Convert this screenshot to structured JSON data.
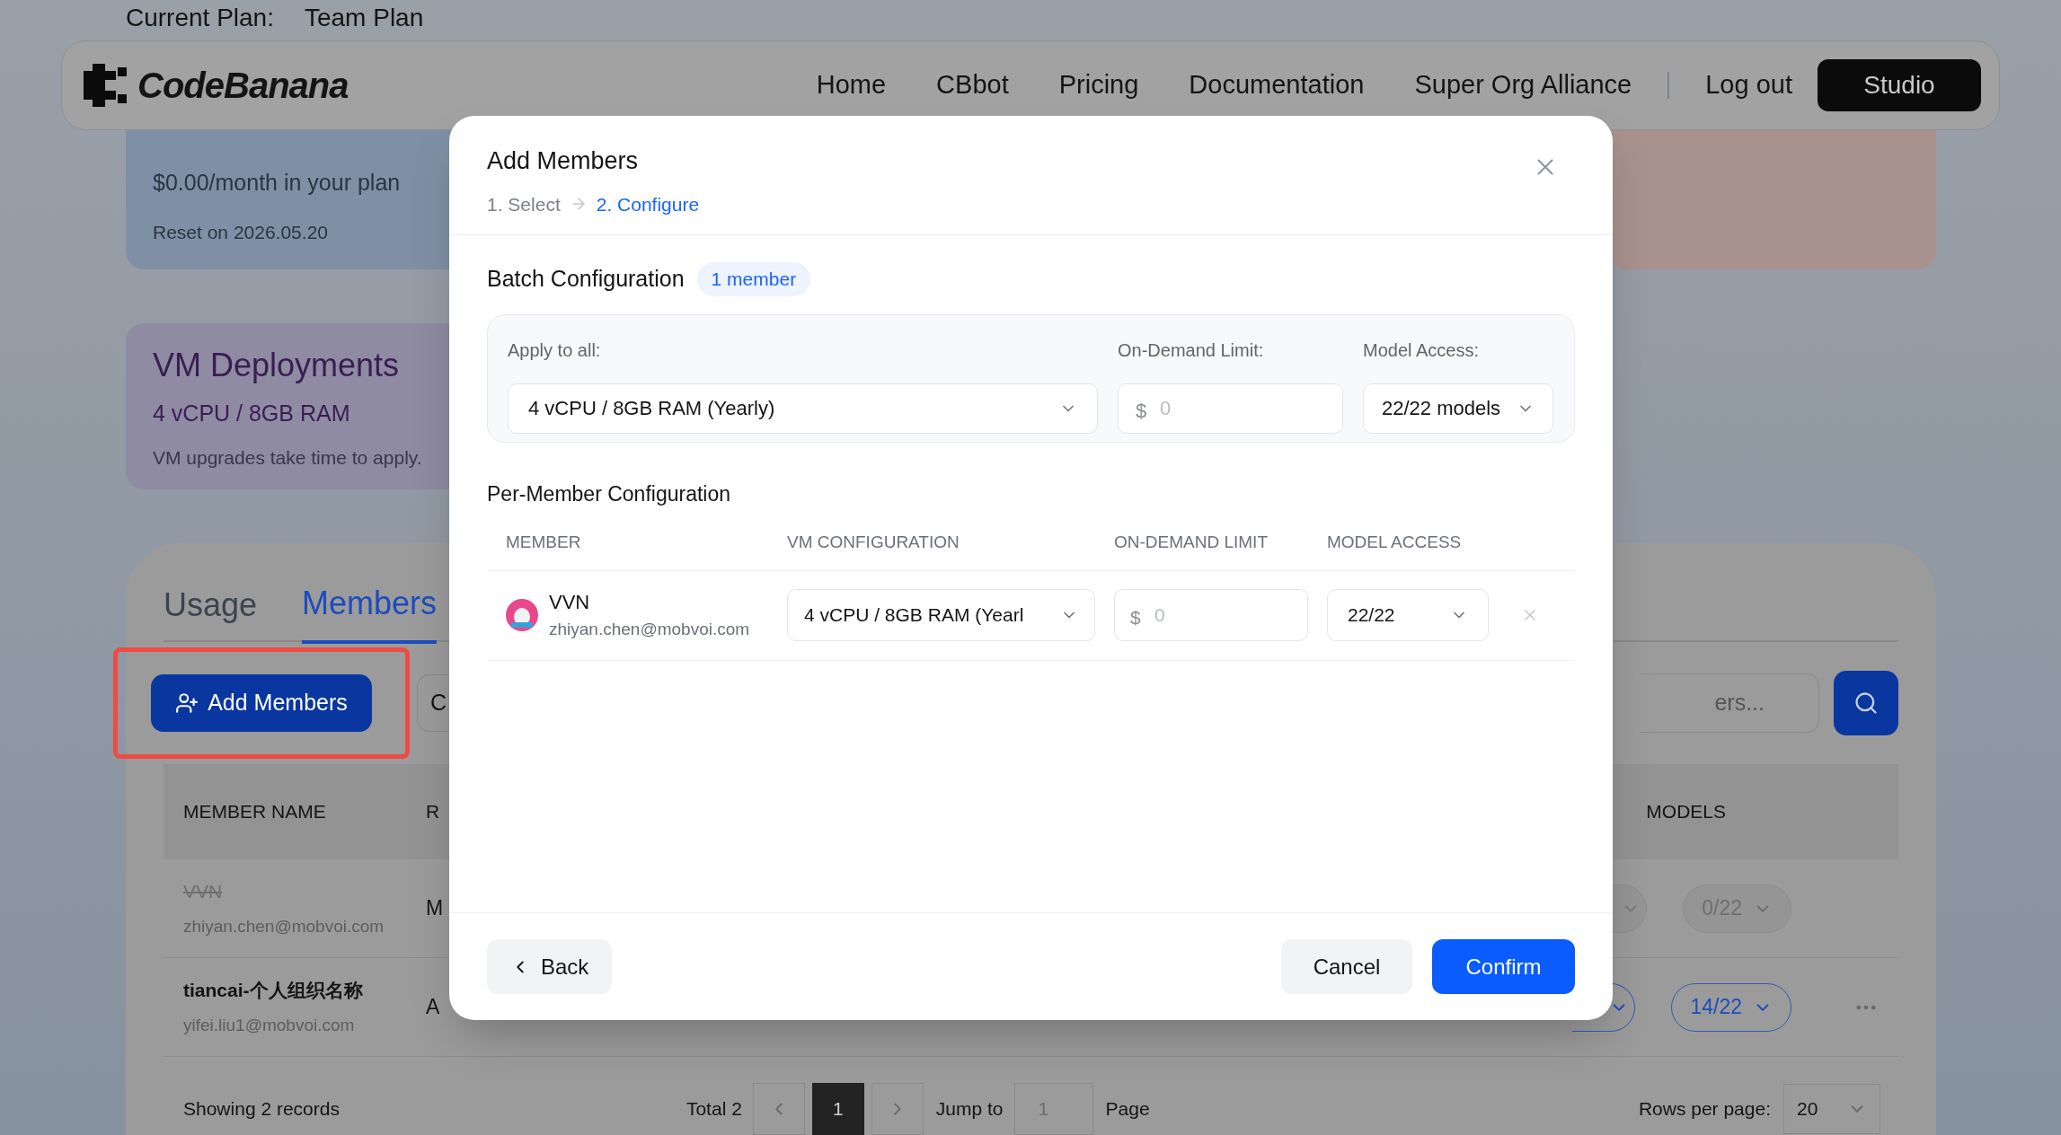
{
  "current_plan": {
    "label": "Current Plan:",
    "value": "Team Plan"
  },
  "nav": {
    "logo": "CodeBanana",
    "links": [
      "Home",
      "CBbot",
      "Pricing",
      "Documentation",
      "Super Org Alliance"
    ],
    "logout": "Log out",
    "studio": "Studio"
  },
  "token_card": {
    "price": "$0.00/month in your plan",
    "reset": "Reset on 2026.05.20"
  },
  "vm_card": {
    "title": "VM Deployments",
    "spec": "4 vCPU / 8GB RAM",
    "note": "VM upgrades take time to apply."
  },
  "tabs": [
    {
      "label": "Usage",
      "selected": false
    },
    {
      "label": "Members",
      "selected": true
    }
  ],
  "toolbar": {
    "add_button": {
      "label": "Add Members",
      "highlighted": true
    },
    "button_2": "C",
    "search": {
      "placeholder": "ers..."
    }
  },
  "members_table": {
    "columns": [
      "MEMBER NAME",
      "R",
      "MODELS"
    ],
    "rows": [
      {
        "name": "VVN",
        "email": "zhiyan.chen@mobvoi.com",
        "role": "M",
        "removed": true,
        "models": "0/22",
        "active": false
      },
      {
        "name": "tiancai-个人组织名称",
        "email": "yifei.liu1@mobvoi.com",
        "role": "A",
        "removed": false,
        "models": "14/22",
        "active": true
      }
    ]
  },
  "footer": {
    "records": "Showing 2 records",
    "total": "Total 2",
    "pages": [
      {
        "label": "1",
        "selected": true
      }
    ],
    "jump_label": "Jump to",
    "jump_placeholder": "1",
    "page_label": "Page",
    "rows_label": "Rows per page:",
    "rows_value": "20"
  },
  "modal": {
    "title": "Add Members",
    "steps": [
      {
        "label": "1. Select",
        "selected": false
      },
      {
        "label": "2. Configure",
        "selected": true
      }
    ],
    "batch": {
      "title": "Batch Configuration",
      "badge": "1 member",
      "apply_label": "Apply to all:",
      "apply_value": "4 vCPU / 8GB RAM (Yearly)",
      "limit_label": "On-Demand Limit:",
      "limit_prefix": "$",
      "limit_placeholder": "0",
      "access_label": "Model Access:",
      "access_value": "22/22 models"
    },
    "per_member": {
      "title": "Per-Member Configuration",
      "columns": [
        "MEMBER",
        "VM CONFIGURATION",
        "ON-DEMAND LIMIT",
        "MODEL ACCESS"
      ],
      "rows": [
        {
          "name": "VVN",
          "email": "zhiyan.chen@mobvoi.com",
          "vm": "4 vCPU / 8GB RAM (Yearl",
          "limit_prefix": "$",
          "limit_placeholder": "0",
          "access": "22/22"
        }
      ]
    },
    "buttons": {
      "back": "Back",
      "cancel": "Cancel",
      "confirm": "Confirm"
    }
  }
}
